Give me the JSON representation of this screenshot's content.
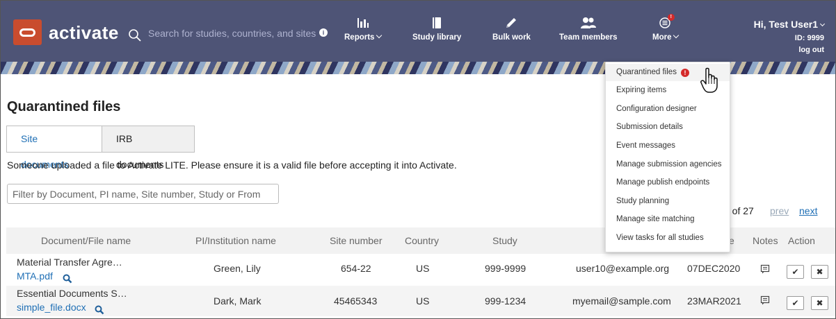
{
  "header": {
    "brand": "activate",
    "search_placeholder": "Search for studies, countries, and sites",
    "nav": [
      {
        "label": "Reports",
        "icon": "bar-chart-icon",
        "has_menu": true
      },
      {
        "label": "Study library",
        "icon": "book-icon",
        "has_menu": false
      },
      {
        "label": "Bulk work",
        "icon": "pencil-icon",
        "has_menu": false
      },
      {
        "label": "Team members",
        "icon": "team-icon",
        "has_menu": false
      },
      {
        "label": "More",
        "icon": "more-menu-icon",
        "badge": "!",
        "has_menu": true
      }
    ],
    "user": {
      "greeting": "Hi, Test User1",
      "id_text": "ID: 9999",
      "logout": "log out"
    }
  },
  "main": {
    "title": "Quarantined files",
    "tabs": [
      "Site documents",
      "IRB documents"
    ],
    "active_tab": "Site documents",
    "notice": "Someone uploaded a file to Activate LITE. Please ensure it is a valid file before accepting it into Activate.",
    "filter_placeholder": "Filter by Document, PI name, Site number, Study or From",
    "pager": {
      "count_text": "6 of 27",
      "prev": "prev",
      "next": "next"
    }
  },
  "table": {
    "columns": [
      "Document/File name",
      "PI/Institution name",
      "Site number",
      "Country",
      "Study",
      "",
      "e",
      "Notes",
      "Action"
    ],
    "rows": [
      {
        "doc_title": "Material Transfer Agre…",
        "file": "MTA.pdf",
        "pi": "Green, Lily",
        "site": "654-22",
        "country": "US",
        "study": "999-9999",
        "from": "user10@example.org",
        "date": "07DEC2020"
      },
      {
        "doc_title": "Essential Documents S…",
        "file": "simple_file.docx",
        "pi": "Dark, Mark",
        "site": "45465343",
        "country": "US",
        "study": "999-1234",
        "from": "myemail@sample.com",
        "date": "23MAR2021"
      }
    ]
  },
  "more_menu": {
    "items": [
      {
        "label": "Quarantined files",
        "alert": "!"
      },
      {
        "label": "Expiring items"
      },
      {
        "label": "Configuration designer"
      },
      {
        "label": "Submission details"
      },
      {
        "label": "Event messages"
      },
      {
        "label": "Manage submission agencies"
      },
      {
        "label": "Manage publish endpoints"
      },
      {
        "label": "Study planning"
      },
      {
        "label": "Manage site matching"
      },
      {
        "label": "View tasks for all studies"
      }
    ]
  },
  "colors": {
    "header_bg": "#4e5476",
    "brand_logo": "#c94c2e",
    "link": "#1f6fb5",
    "alert": "#d42a2a"
  }
}
